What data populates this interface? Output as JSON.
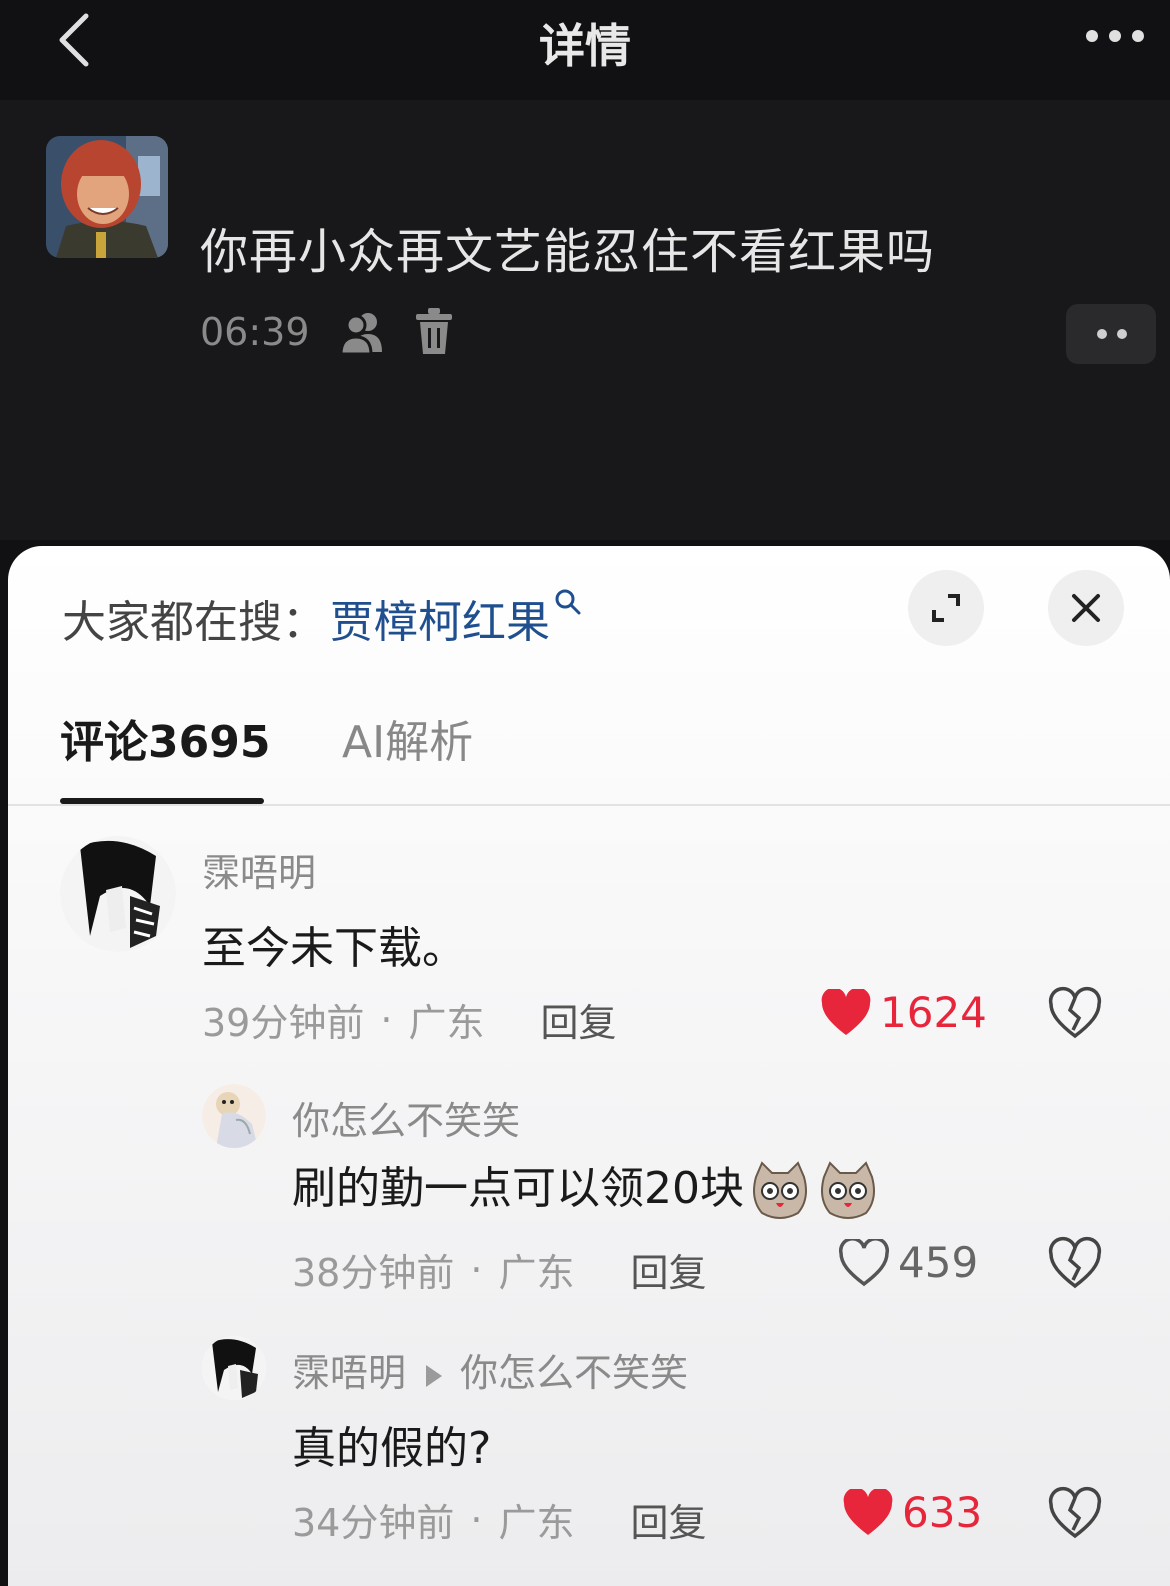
{
  "header": {
    "title": "详情",
    "back_icon": "chevron-left-icon",
    "more_icon": "ellipsis-icon"
  },
  "post": {
    "text": "你再小众再文艺能忍住不看红果吗",
    "time": "06:39"
  },
  "search": {
    "label": "大家都在搜：",
    "term": "贾樟柯红果"
  },
  "tabs": {
    "comments": "评论3695",
    "ai": "AI解析"
  },
  "comments": [
    {
      "author": "霂唔明",
      "text": "至今未下载。",
      "time": "39分钟前",
      "location": "广东",
      "reply": "回复",
      "likes": "1624",
      "liked": true
    },
    {
      "author": "你怎么不笑笑",
      "text": "刷的勤一点可以领20块",
      "time": "38分钟前",
      "location": "广东",
      "reply": "回复",
      "likes": "459",
      "liked": false
    },
    {
      "author": "霂唔明",
      "reply_to": "你怎么不笑笑",
      "text": "真的假的?",
      "time": "34分钟前",
      "location": "广东",
      "reply": "回复",
      "likes": "633",
      "liked": true
    }
  ],
  "colors": {
    "accent_like": "#e8263b",
    "link": "#1f4f8f",
    "dark_bg": "#111113"
  }
}
